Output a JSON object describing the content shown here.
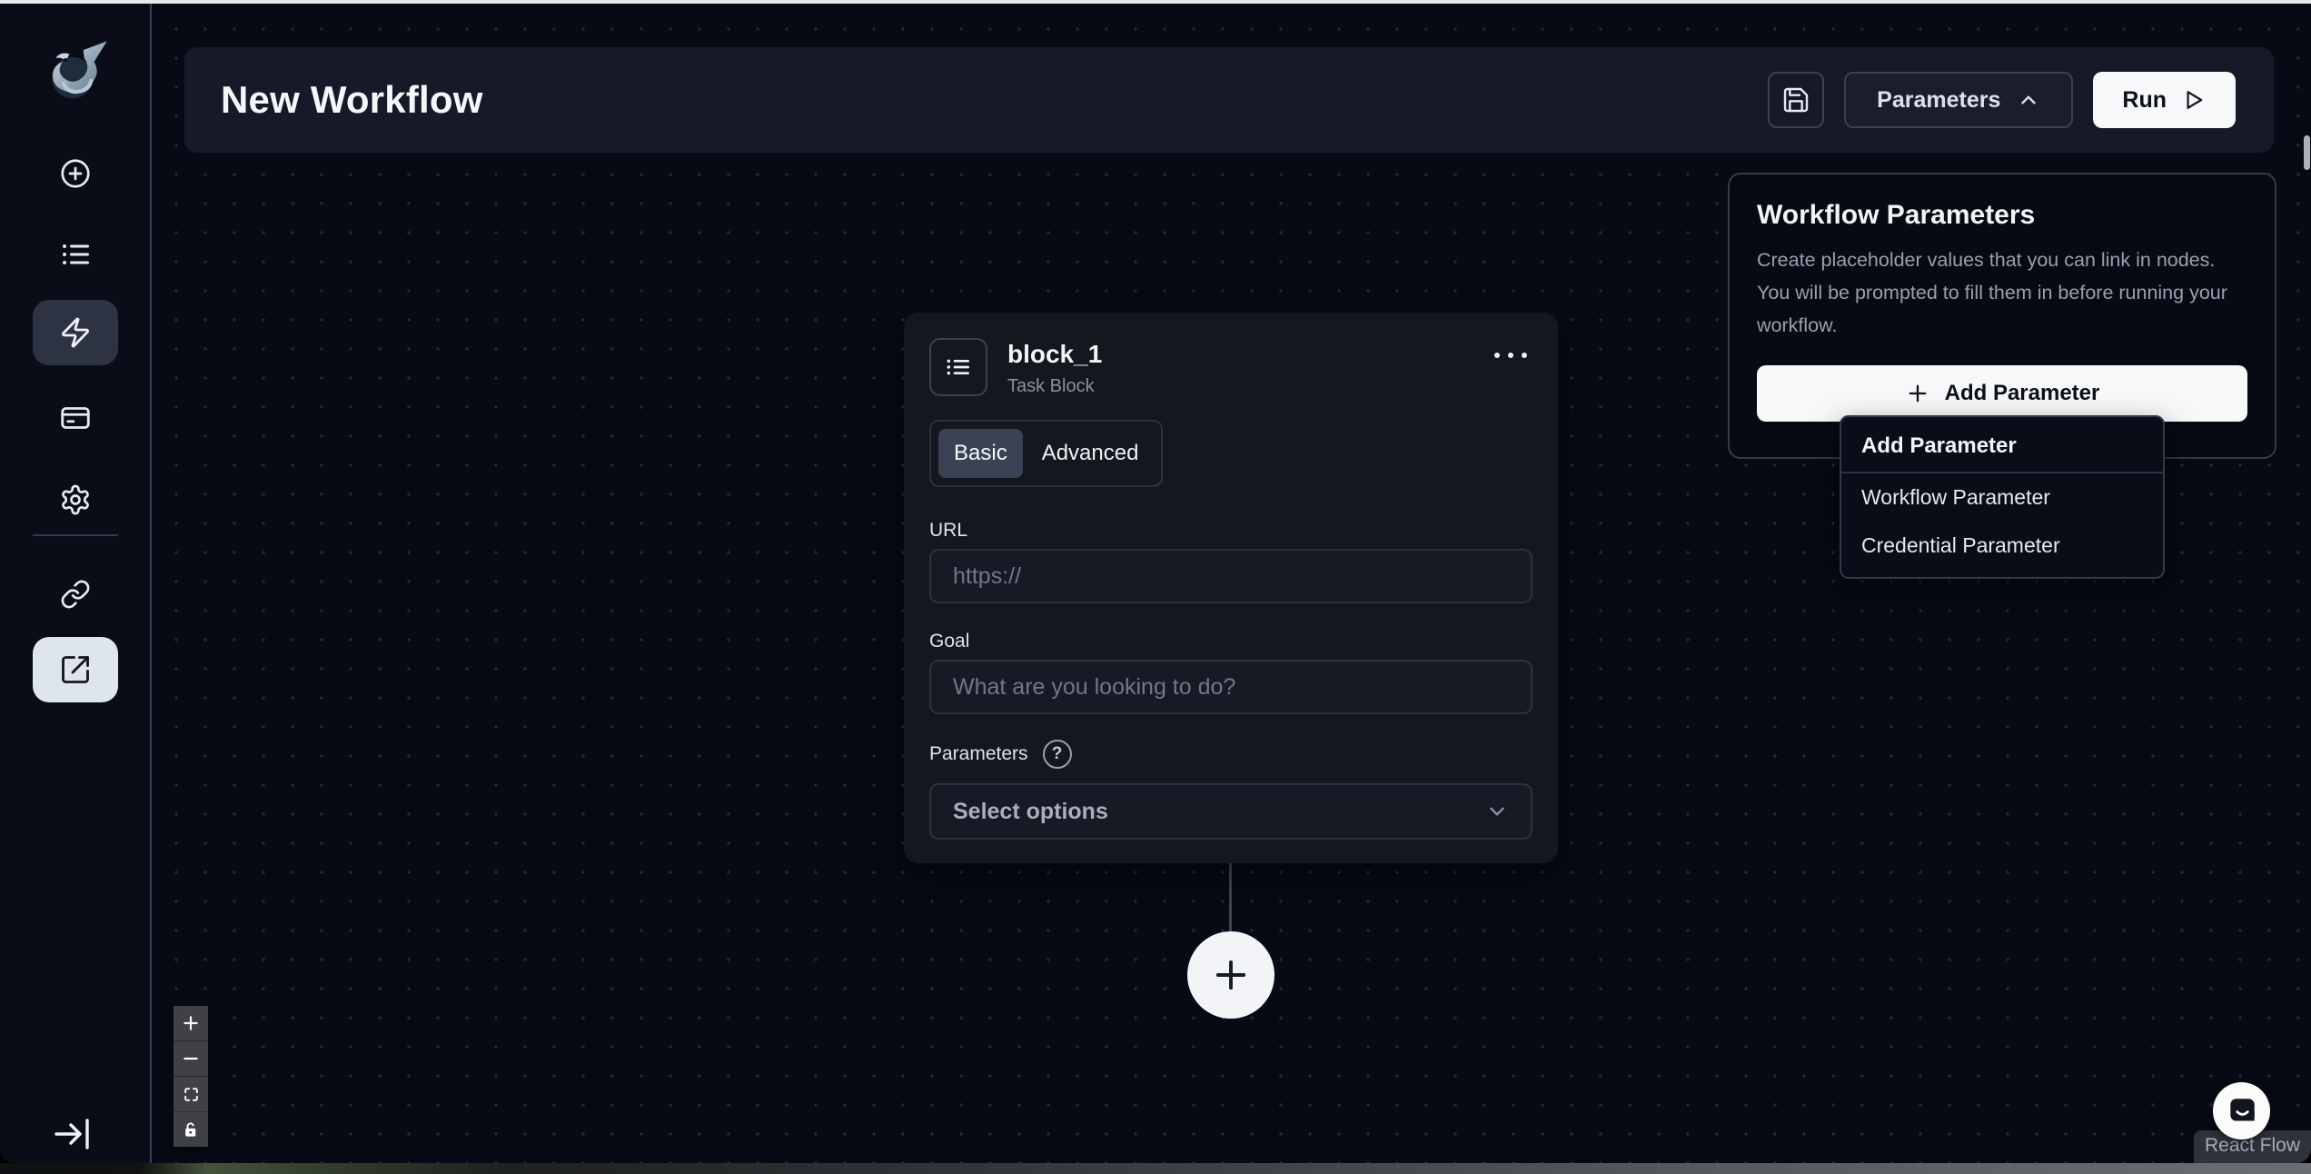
{
  "header": {
    "title": "New Workflow",
    "parameters_button": "Parameters",
    "run_button": "Run"
  },
  "block": {
    "name": "block_1",
    "type_label": "Task Block",
    "tabs": [
      "Basic",
      "Advanced"
    ],
    "url_label": "URL",
    "url_placeholder": "https://",
    "goal_label": "Goal",
    "goal_placeholder": "What are you looking to do?",
    "parameters_label": "Parameters",
    "help_glyph": "?",
    "select_options_label": "Select options"
  },
  "workflow_parameters_panel": {
    "title": "Workflow Parameters",
    "description": "Create placeholder values that you can link in nodes.\nYou will be prompted to fill them in before running your\nworkflow.",
    "add_button_label": "Add Parameter"
  },
  "add_parameter_menu": {
    "header": "Add Parameter",
    "items": [
      "Workflow Parameter",
      "Credential Parameter"
    ]
  },
  "attribution": {
    "label": "React Flow"
  },
  "colors": {
    "canvas_bg": "#060a14",
    "sidebar_bg": "#0a0d18",
    "header_bg": "#161a28",
    "card_bg": "#15171f",
    "accent_light": "#f7f8fa",
    "border": "#3a4150",
    "active_tab_bg": "#3a4254",
    "text_primary": "#f2f4f8",
    "text_muted": "#97a0b0"
  }
}
